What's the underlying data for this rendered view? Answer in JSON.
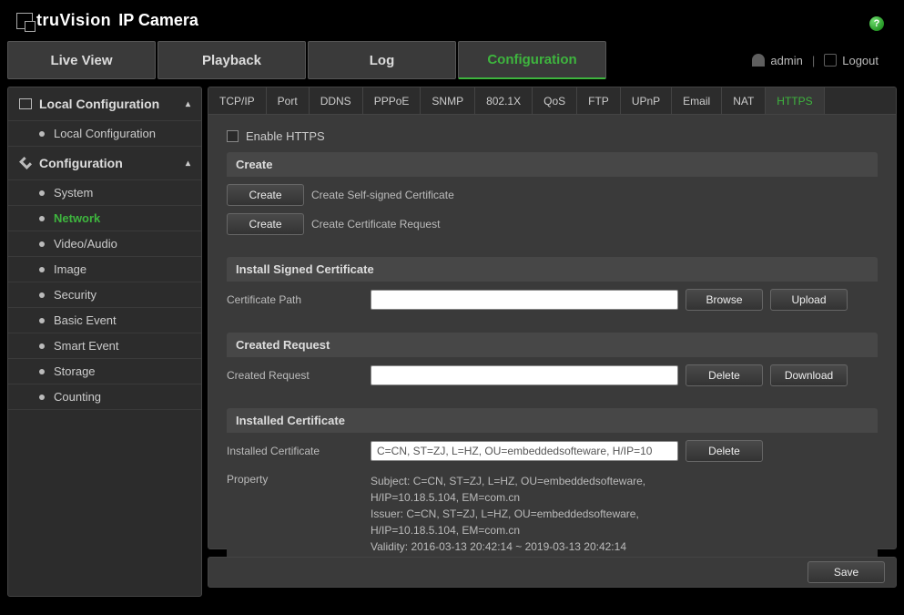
{
  "brand": {
    "name": "truVision",
    "product": "IP Camera"
  },
  "nav": {
    "liveview": "Live View",
    "playback": "Playback",
    "log": "Log",
    "configuration": "Configuration",
    "user": "admin",
    "logout": "Logout"
  },
  "sidebar": {
    "local_cfg_title": "Local Configuration",
    "local_cfg_item": "Local Configuration",
    "cfg_title": "Configuration",
    "items": {
      "system": "System",
      "network": "Network",
      "video_audio": "Video/Audio",
      "image": "Image",
      "security": "Security",
      "basic_event": "Basic Event",
      "smart_event": "Smart Event",
      "storage": "Storage",
      "counting": "Counting"
    }
  },
  "tabs": {
    "tcpip": "TCP/IP",
    "port": "Port",
    "ddns": "DDNS",
    "pppoe": "PPPoE",
    "snmp": "SNMP",
    "8021x": "802.1X",
    "qos": "QoS",
    "ftp": "FTP",
    "upnp": "UPnP",
    "email": "Email",
    "nat": "NAT",
    "https": "HTTPS"
  },
  "https": {
    "enable_label": "Enable  HTTPS",
    "create_hd": "Create",
    "create_btn": "Create",
    "create_self_signed": "Create Self-signed Certificate",
    "create_req_btn": "Create",
    "create_req": "Create Certificate Request",
    "install_hd": "Install Signed Certificate",
    "cert_path_label": "Certificate Path",
    "cert_path_value": "",
    "browse_btn": "Browse",
    "upload_btn": "Upload",
    "created_req_hd": "Created Request",
    "created_req_label": "Created Request",
    "created_req_value": "",
    "delete_btn": "Delete",
    "download_btn": "Download",
    "installed_hd": "Installed Certificate",
    "installed_label": "Installed Certificate",
    "installed_value": "C=CN, ST=ZJ, L=HZ, OU=embeddedsofteware, H/IP=10",
    "delete2_btn": "Delete",
    "property_label": "Property",
    "property_lines": {
      "l1": "Subject: C=CN, ST=ZJ, L=HZ, OU=embeddedsofteware,",
      "l2": "H/IP=10.18.5.104, EM=com.cn",
      "l3": "Issuer: C=CN, ST=ZJ, L=HZ, OU=embeddedsofteware,",
      "l4": "H/IP=10.18.5.104, EM=com.cn",
      "l5": "Validity: 2016-03-13 20:42:14 ~ 2019-03-13 20:42:14"
    }
  },
  "save_btn": "Save"
}
